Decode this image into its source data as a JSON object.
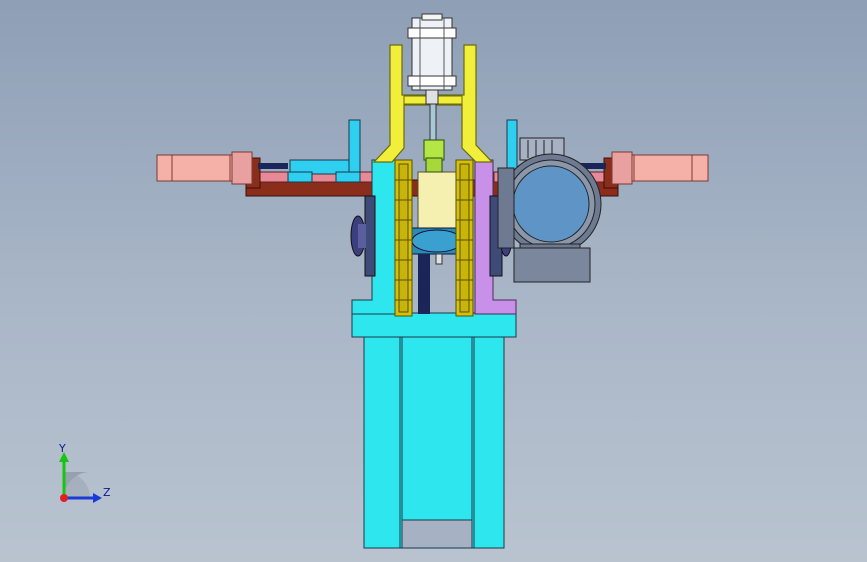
{
  "triad": {
    "y_label": "Y",
    "z_label": "Z"
  },
  "colors": {
    "background_top": "#8e9fb6",
    "background_bottom": "#b9c3d0",
    "cyan": "#2ee6ee",
    "yellow": "#f2ef3a",
    "sprocket": "#d4c20a",
    "brown": "#8a2d1a",
    "pink": "#e8a0a0",
    "purple": "#c890e8",
    "motor_blue": "#5f95c6",
    "dark_navy": "#1b2558",
    "cream": "#f6f0b0"
  }
}
